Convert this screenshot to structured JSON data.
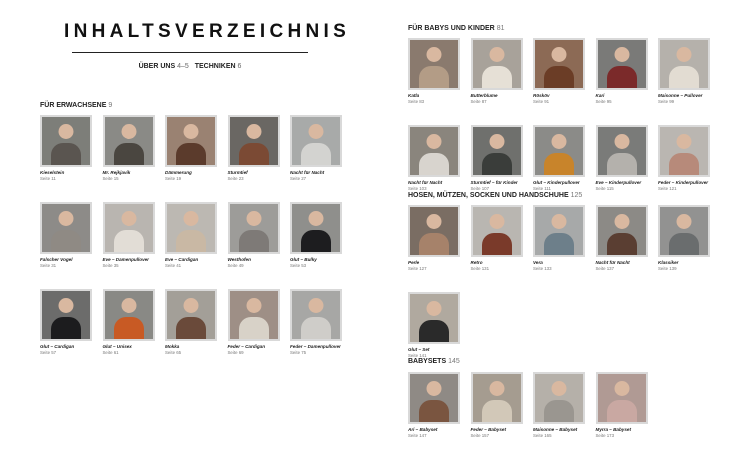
{
  "left": {
    "title": "INHALTSVERZEICHNIS",
    "links": [
      {
        "label": "ÜBER UNS",
        "page": "4–5"
      },
      {
        "label": "TECHNIKEN",
        "page": "6"
      }
    ],
    "sections": [
      {
        "heading": "FÜR ERWACHSENE",
        "page": "9",
        "items": [
          {
            "name": "Kieselstein",
            "page": "Seite 11",
            "bg": "#7d7e79",
            "body": "#5a5550"
          },
          {
            "name": "Mr. Rejkjavik",
            "page": "Seite 15",
            "bg": "#8a8a86",
            "body": "#4a4640"
          },
          {
            "name": "Dämmerung",
            "page": "Seite 19",
            "bg": "#9a8272",
            "body": "#5b3b2c"
          },
          {
            "name": "Sturmtief",
            "page": "Seite 23",
            "bg": "#6a6763",
            "body": "#7b4a34"
          },
          {
            "name": "Nacht für Nacht",
            "page": "Seite 27",
            "bg": "#a8aaa9",
            "body": "#d3d3d0"
          },
          {
            "name": "Falscher Vogel",
            "page": "Seite 31",
            "bg": "#8d8b88",
            "body": "#8f8a84"
          },
          {
            "name": "Eve – Damenpullover",
            "page": "Seite 35",
            "bg": "#b9b5b0",
            "body": "#e2ddd6"
          },
          {
            "name": "Eve – Cardigan",
            "page": "Seite 41",
            "bg": "#bcb8b2",
            "body": "#c9b8a4"
          },
          {
            "name": "Westhofen",
            "page": "Seite 49",
            "bg": "#9d9c99",
            "body": "#7e7a77"
          },
          {
            "name": "Glut – Bulky",
            "page": "Seite 53",
            "bg": "#8f8f8c",
            "body": "#1d1d1f"
          },
          {
            "name": "Glut – Cardigan",
            "page": "Seite 57",
            "bg": "#6c6c6b",
            "body": "#1c1c1e"
          },
          {
            "name": "Glut – Unisex",
            "page": "Seite 61",
            "bg": "#898985",
            "body": "#c85a24"
          },
          {
            "name": "Mokka",
            "page": "Seite 65",
            "bg": "#a39f98",
            "body": "#6a4a3a"
          },
          {
            "name": "Feder – Cardigan",
            "page": "Seite 69",
            "bg": "#9e8f86",
            "body": "#d8d2c8"
          },
          {
            "name": "Feder – Damenpullover",
            "page": "Seite 75",
            "bg": "#a7a7a5",
            "body": "#cfcdc9"
          }
        ]
      }
    ]
  },
  "right": {
    "sections": [
      {
        "heading": "FÜR BABYS UND KINDER",
        "page": "81",
        "items": [
          {
            "name": "Katla",
            "page": "Seite 83",
            "bg": "#8a7a6e",
            "body": "#b39c86"
          },
          {
            "name": "Butterblume",
            "page": "Seite 87",
            "bg": "#a8a29a",
            "body": "#e6e0d6"
          },
          {
            "name": "Rösköv",
            "page": "Seite 91",
            "bg": "#8c6a55",
            "body": "#6b3d26"
          },
          {
            "name": "Kari",
            "page": "Seite 95",
            "bg": "#7a7a78",
            "body": "#7b2a2a"
          },
          {
            "name": "Maisonne – Pullover",
            "page": "Seite 99",
            "bg": "#b5b1ab",
            "body": "#e2dcd2"
          },
          {
            "name": "Nacht für Nacht",
            "page": "Seite 103",
            "bg": "#8a857d",
            "body": "#d8d4ce"
          },
          {
            "name": "Sturmtief – für Kinder",
            "page": "Seite 107",
            "bg": "#6f706d",
            "body": "#3a3d3a"
          },
          {
            "name": "Glut – Kinderpullover",
            "page": "Seite 111",
            "bg": "#8b8b88",
            "body": "#c8842b"
          },
          {
            "name": "Eve – Kinderpullover",
            "page": "Seite 115",
            "bg": "#7a7b79",
            "body": "#b4b1ac"
          },
          {
            "name": "Feder – Kinderpullover",
            "page": "Seite 121",
            "bg": "#bab6b1",
            "body": "#b78a7a"
          }
        ]
      },
      {
        "heading": "HOSEN, MÜTZEN, SOCKEN UND HANDSCHUHE",
        "page": "125",
        "items": [
          {
            "name": "Perle",
            "page": "Seite 127",
            "bg": "#7a6d63",
            "body": "#a6826a"
          },
          {
            "name": "Retro",
            "page": "Seite 131",
            "bg": "#b9b6b1",
            "body": "#7a3a2a"
          },
          {
            "name": "Vera",
            "page": "Seite 133",
            "bg": "#a7a9a9",
            "body": "#6d7f8a"
          },
          {
            "name": "Nacht für Nacht",
            "page": "Seite 137",
            "bg": "#8c8a86",
            "body": "#5a3e32"
          },
          {
            "name": "Klassiker",
            "page": "Seite 139",
            "bg": "#929291",
            "body": "#6a6d6e"
          },
          {
            "name": "Glut – Set",
            "page": "Seite 141",
            "bg": "#b0a99f",
            "body": "#2a2a2a"
          }
        ]
      },
      {
        "heading": "BABYSETS",
        "page": "145",
        "items": [
          {
            "name": "Ari – Babyset",
            "page": "Seite 147",
            "bg": "#8f8a85",
            "body": "#7a5540"
          },
          {
            "name": "Feder – Babyset",
            "page": "Seite 157",
            "bg": "#a59c90",
            "body": "#d2c8b8"
          },
          {
            "name": "Maisonne – Babyset",
            "page": "Seite 165",
            "bg": "#b5b0a9",
            "body": "#9a9690"
          },
          {
            "name": "Myrra – Babyset",
            "page": "Seite 173",
            "bg": "#b09a94",
            "body": "#c9a8a2"
          }
        ]
      }
    ]
  }
}
